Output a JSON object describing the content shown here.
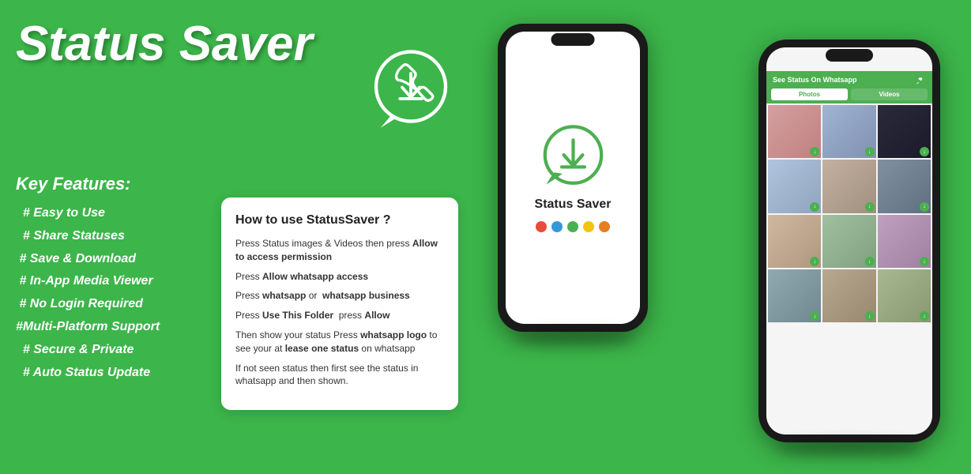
{
  "title": "Status Saver",
  "keyFeatures": {
    "heading": "Key Features:",
    "items": [
      "# Easy to Use",
      "# Share Statuses",
      "# Save & Download",
      "# In-App Media Viewer",
      "# No Login Required",
      "# Multi-Platform Support",
      "# Secure & Private",
      "# Auto Status Update"
    ]
  },
  "howToUse": {
    "title": "How to use StatusSaver ?",
    "steps": [
      {
        "text": "Press Status images & Videos then press ",
        "bold": "Allow to access permission"
      },
      {
        "text": "Press ",
        "bold": "Allow whatsapp access"
      },
      {
        "text": "Press ",
        "bold": "whatsapp",
        "mid": " or ",
        "bold2": "whatsapp business"
      },
      {
        "text": "Press ",
        "bold": "Use This Folder",
        "mid2": " press ",
        "bold3": "Allow"
      },
      {
        "text": "Then show your status Press ",
        "bold": "whatsapp logo",
        "suffix": " to see your at ",
        "bold4": "lease one status",
        "after": " on whatsapp"
      },
      {
        "text": "If not seen status then first see the status in whatsapp and then shown."
      }
    ]
  },
  "phone1": {
    "appTitle": "Status Saver",
    "dots": [
      "#e74c3c",
      "#3498db",
      "#4caf50",
      "#f1c40f",
      "#e67e22"
    ]
  },
  "phone2": {
    "header": "See Status On Whatsapp",
    "tabs": [
      "Photos",
      "Videos"
    ],
    "photoCount": 12
  },
  "colors": {
    "bg": "#3cb54a",
    "white": "#ffffff",
    "appGreen": "#4caf50"
  }
}
